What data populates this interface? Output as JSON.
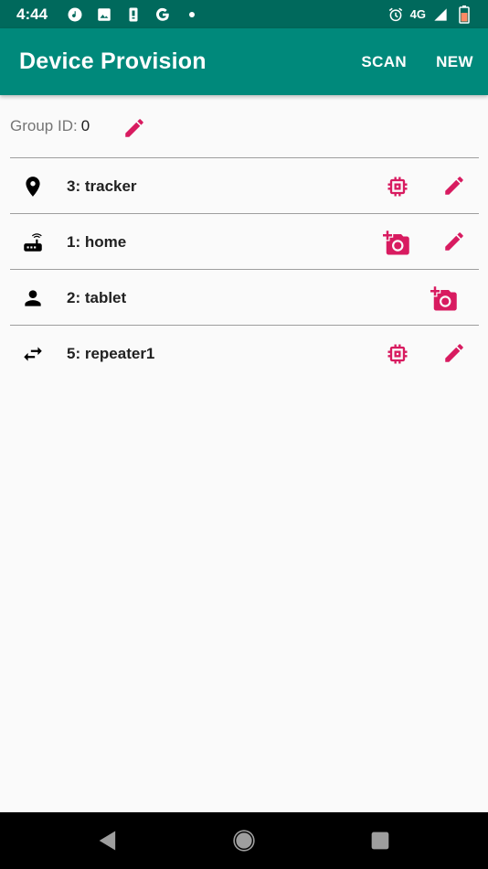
{
  "status_bar": {
    "time": "4:44",
    "network": "4G",
    "left_icons": [
      "music-icon",
      "image-icon",
      "sim-icon",
      "google-icon",
      "dot-icon"
    ],
    "right_icons": [
      "alarm-icon",
      "signal-icon",
      "battery-icon"
    ]
  },
  "app_bar": {
    "title": "Device Provision",
    "actions": [
      "SCAN",
      "NEW"
    ]
  },
  "group": {
    "label": "Group ID:",
    "value": "0"
  },
  "devices": [
    {
      "label": "3: tracker",
      "icon": "location-pin-icon",
      "actions": [
        "chip-icon",
        "edit-icon"
      ]
    },
    {
      "label": "1: home",
      "icon": "router-icon",
      "actions": [
        "add-photo-icon",
        "edit-icon"
      ]
    },
    {
      "label": "2: tablet",
      "icon": "person-icon",
      "actions": [
        "add-photo-icon"
      ]
    },
    {
      "label": "5: repeater1",
      "icon": "swap-arrows-icon",
      "actions": [
        "chip-icon",
        "edit-icon"
      ]
    }
  ],
  "colors": {
    "status_bar": "#00695c",
    "app_bar": "#00897b",
    "accent": "#d81b60",
    "background": "#fafafa",
    "divider": "#9e9e9e"
  },
  "nav_bar": [
    "back-icon",
    "home-icon",
    "recents-icon"
  ]
}
